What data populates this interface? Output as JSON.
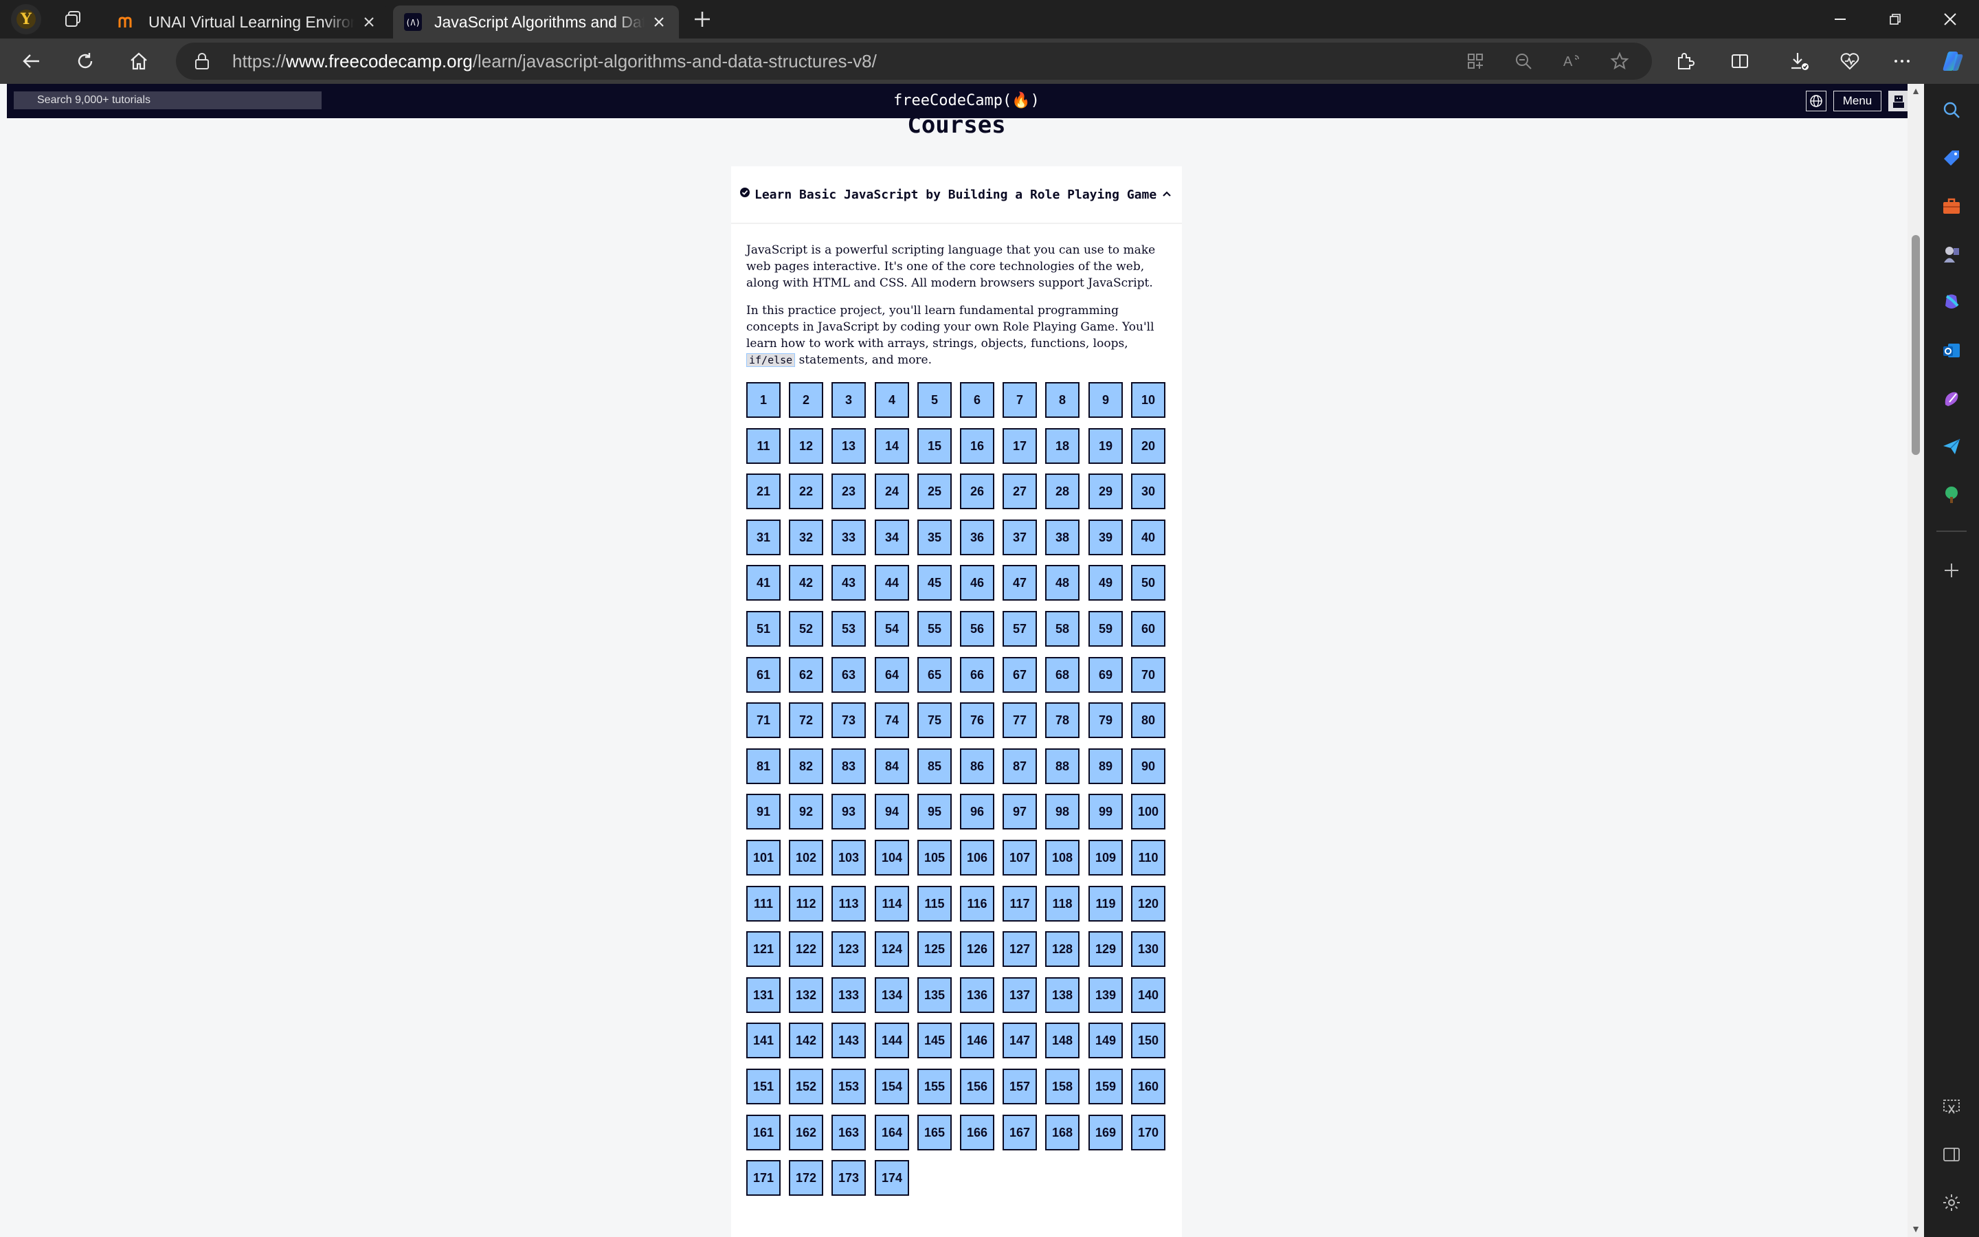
{
  "browser": {
    "tabs": [
      {
        "title": "UNAI Virtual Learning Environment",
        "favicon": "moodle-icon",
        "active": false
      },
      {
        "title": "JavaScript Algorithms and Data Structures",
        "favicon": "freecodecamp-icon",
        "active": true
      }
    ],
    "address": {
      "prefix": "https://",
      "domain": "www.freecodecamp.org",
      "path": "/learn/javascript-algorithms-and-data-structures-v8/"
    }
  },
  "fcc_nav": {
    "search_placeholder": "Search 9,000+ tutorials",
    "logo": "freeCodeCamp(🔥)",
    "menu_label": "Menu"
  },
  "page": {
    "heading": "Courses",
    "block": {
      "title": "Learn Basic JavaScript by Building a Role Playing Game",
      "desc1": "JavaScript is a powerful scripting language that you can use to make web pages interactive. It's one of the core technologies of the web, along with HTML and CSS. All modern browsers support JavaScript.",
      "desc2_before": "In this practice project, you'll learn fundamental programming concepts in JavaScript by coding your own Role Playing Game. You'll learn how to work with arrays, strings, objects, functions, loops, ",
      "desc2_code": "if/else",
      "desc2_after": " statements, and more.",
      "step_count": 174
    }
  },
  "colors": {
    "fcc_dark": "#0a0a23",
    "step_blue": "#99c9ff",
    "browser_dark": "#202020"
  }
}
